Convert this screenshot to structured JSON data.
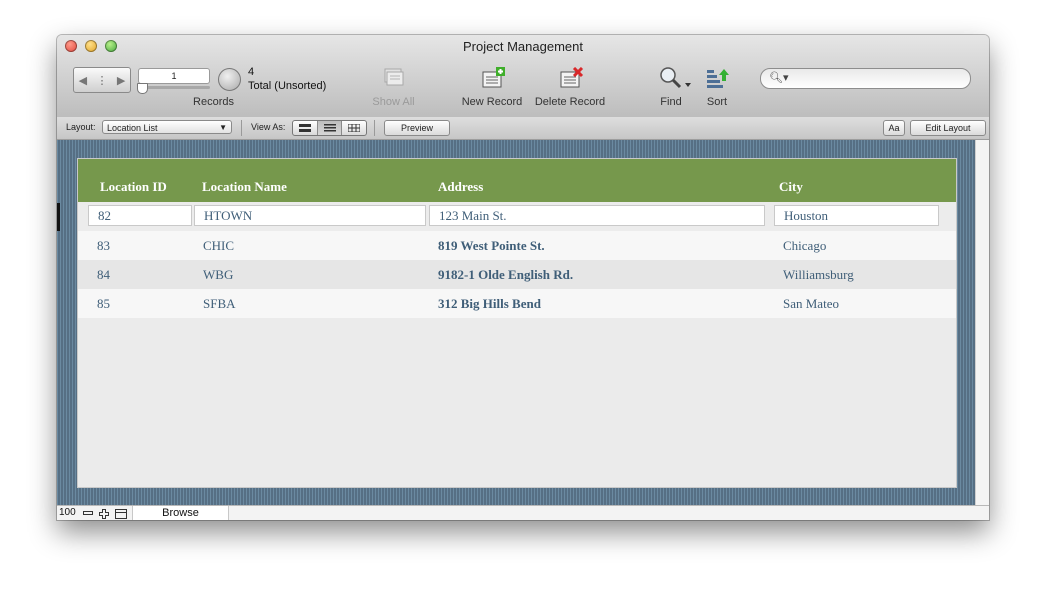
{
  "window": {
    "title": "Project Management"
  },
  "toolbar": {
    "record_current": "1",
    "records_label": "Records",
    "found_count": "4",
    "sort_status": "Total (Unsorted)",
    "show_all_label": "Show All",
    "new_record_label": "New Record",
    "delete_record_label": "Delete Record",
    "find_label": "Find",
    "sort_label": "Sort",
    "search_placeholder": ""
  },
  "layout_bar": {
    "layout_label": "Layout:",
    "layout_value": "Location List",
    "view_as_label": "View As:",
    "preview_label": "Preview",
    "format_label": "Aa",
    "edit_layout_label": "Edit Layout"
  },
  "table": {
    "columns": [
      "Location ID",
      "Location Name",
      "Address",
      "City"
    ],
    "rows": [
      {
        "id": "82",
        "name": "HTOWN",
        "address": "123 Main St.",
        "city": "Houston"
      },
      {
        "id": "83",
        "name": "CHIC",
        "address": "819 West Pointe St.",
        "city": "Chicago"
      },
      {
        "id": "84",
        "name": "WBG",
        "address": "9182-1 Olde English Rd.",
        "city": "Williamsburg"
      },
      {
        "id": "85",
        "name": "SFBA",
        "address": "312 Big Hills Bend",
        "city": "San Mateo"
      }
    ]
  },
  "status_bar": {
    "zoom": "100",
    "mode": "Browse"
  },
  "colors": {
    "header_green": "#76984c",
    "text_blue": "#3f5e78",
    "row_alt": "#e6e6e6",
    "background_stripes": "#5f7f96"
  },
  "icons": [
    "nav-arrows-icon",
    "show-all-icon",
    "new-record-icon",
    "delete-record-icon",
    "find-icon",
    "sort-icon",
    "search-icon"
  ]
}
